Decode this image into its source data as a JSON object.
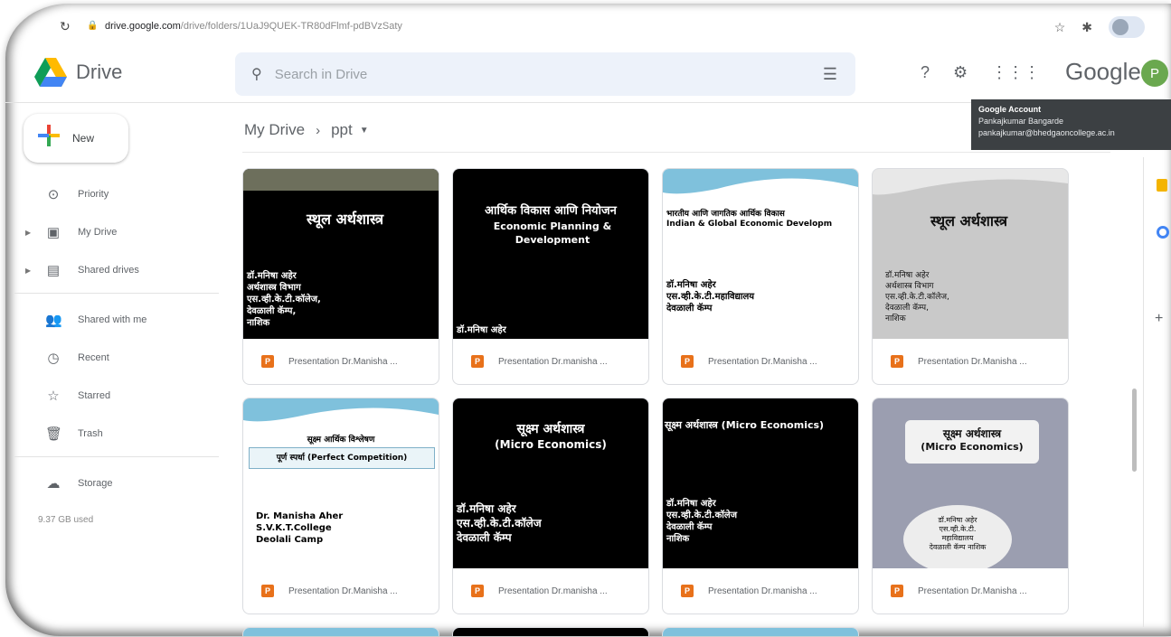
{
  "browser": {
    "url_host": "drive.google.com",
    "url_path": "/drive/folders/1UaJ9QUEK-TR80dFlmf-pdBVzSaty"
  },
  "header": {
    "app_name": "Drive",
    "search_placeholder": "Search in Drive",
    "google_text": "Google",
    "avatar_letter": "P"
  },
  "tooltip": {
    "title": "Google Account",
    "name": "Pankajkumar Bangarde",
    "email": "pankajkumar@bhedgaoncollege.ac.in"
  },
  "sidebar": {
    "new_label": "New",
    "items": [
      {
        "label": "Priority",
        "icon": "check-circle-icon"
      },
      {
        "label": "My Drive",
        "icon": "my-drive-icon"
      },
      {
        "label": "Shared drives",
        "icon": "shared-drives-icon"
      },
      {
        "label": "Shared with me",
        "icon": "people-icon"
      },
      {
        "label": "Recent",
        "icon": "clock-icon"
      },
      {
        "label": "Starred",
        "icon": "star-icon"
      },
      {
        "label": "Trash",
        "icon": "trash-icon"
      },
      {
        "label": "Storage",
        "icon": "cloud-icon"
      }
    ],
    "storage_used": "9.37 GB used"
  },
  "breadcrumb": {
    "root": "My Drive",
    "current": "ppt"
  },
  "files": [
    {
      "name": "Presentation Dr.Manisha ...",
      "title": "स्थूल अर्थशास्त्र",
      "lines": [
        "डॉ.मनिषा अहेर",
        "अर्थशास्त्र विभाग",
        "एस.व्ही.के.टी.कॉलेज,",
        "देवळाली कॅम्प,",
        "नाशिक"
      ]
    },
    {
      "name": "Presentation Dr.manisha ...",
      "title": "आर्थिक विकास आणि नियोजन",
      "subtitle": "Economic Planning & Development",
      "lines": [
        "डॉ.मनिषा अहेर"
      ]
    },
    {
      "name": "Presentation Dr.Manisha ...",
      "title": "भारतीय आणि जागतिक आर्थिक विकास",
      "subtitle": "Indian & Global Economic Developm",
      "lines": [
        "डॉ.मनिषा अहेर",
        "एस.व्ही.के.टी.महाविद्यालय",
        "देवळाली कॅम्प"
      ]
    },
    {
      "name": "Presentation Dr.Manisha ...",
      "title": "स्थूल अर्थशास्त्र",
      "lines": [
        "डॉ.मनिषा अहेर",
        "अर्थशास्त्र विभाग",
        "एस.व्ही.के.टी.कॉलेज,",
        "देवळाली कॅम्प,",
        "नाशिक"
      ]
    },
    {
      "name": "Presentation Dr.Manisha ...",
      "title": "सूक्ष्म आर्थिक विश्लेषण",
      "subtitle": "पूर्ण स्पर्धा (Perfect Competition)",
      "lines": [
        "Dr. Manisha Aher",
        "S.V.K.T.College",
        "Deolali Camp"
      ]
    },
    {
      "name": "Presentation Dr.manisha ...",
      "title": "सूक्ष्म अर्थशास्त्र",
      "subtitle": "(Micro Economics)",
      "lines": [
        "डॉ.मनिषा अहेर",
        "एस.व्ही.के.टी.कॉलेज",
        "देवळाली कॅम्प"
      ]
    },
    {
      "name": "Presentation Dr.manisha ...",
      "title": "सूक्ष्म अर्थशास्त्र (Micro Economics)",
      "lines": [
        "डॉ.मनिषा अहेर",
        "एस.व्ही.के.टी.कॉलेज",
        "देवळाली कॅम्प",
        "नाशिक"
      ]
    },
    {
      "name": "Presentation Dr.Manisha ...",
      "title": "सूक्ष्म अर्थशास्त्र",
      "subtitle": "(Micro Economics)",
      "lines": [
        "डॉ.मनिषा अहेर",
        "एस.व्ही.के.टी.",
        "महाविद्यालय",
        "देवळाली कॅम्प नाशिक"
      ]
    }
  ]
}
